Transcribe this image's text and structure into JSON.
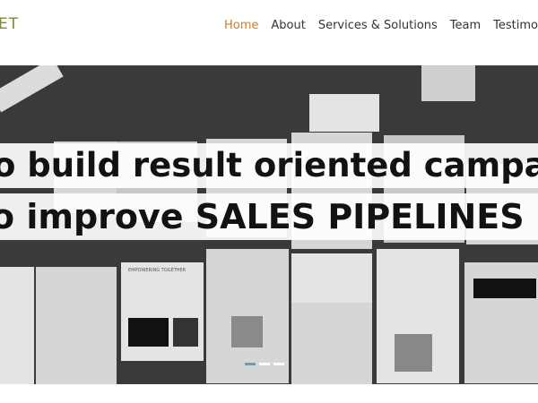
{
  "brand": {
    "logo_text": "ET"
  },
  "nav": {
    "items": [
      {
        "label": "Home",
        "active": true
      },
      {
        "label": "About",
        "active": false
      },
      {
        "label": "Services & Solutions",
        "active": false
      },
      {
        "label": "Team",
        "active": false
      },
      {
        "label": "Testimonials",
        "active": false
      }
    ]
  },
  "hero": {
    "line1": "o build result oriented campai",
    "line2": "o improve SALES PIPELINES",
    "paper_caption": "EMPOWERING TOGETHER",
    "slider": {
      "slides": 3,
      "active_index": 0
    }
  },
  "colors": {
    "accent": "#dd7722",
    "brand": "#7c8b3c",
    "slider_active": "#5aa0c8"
  }
}
